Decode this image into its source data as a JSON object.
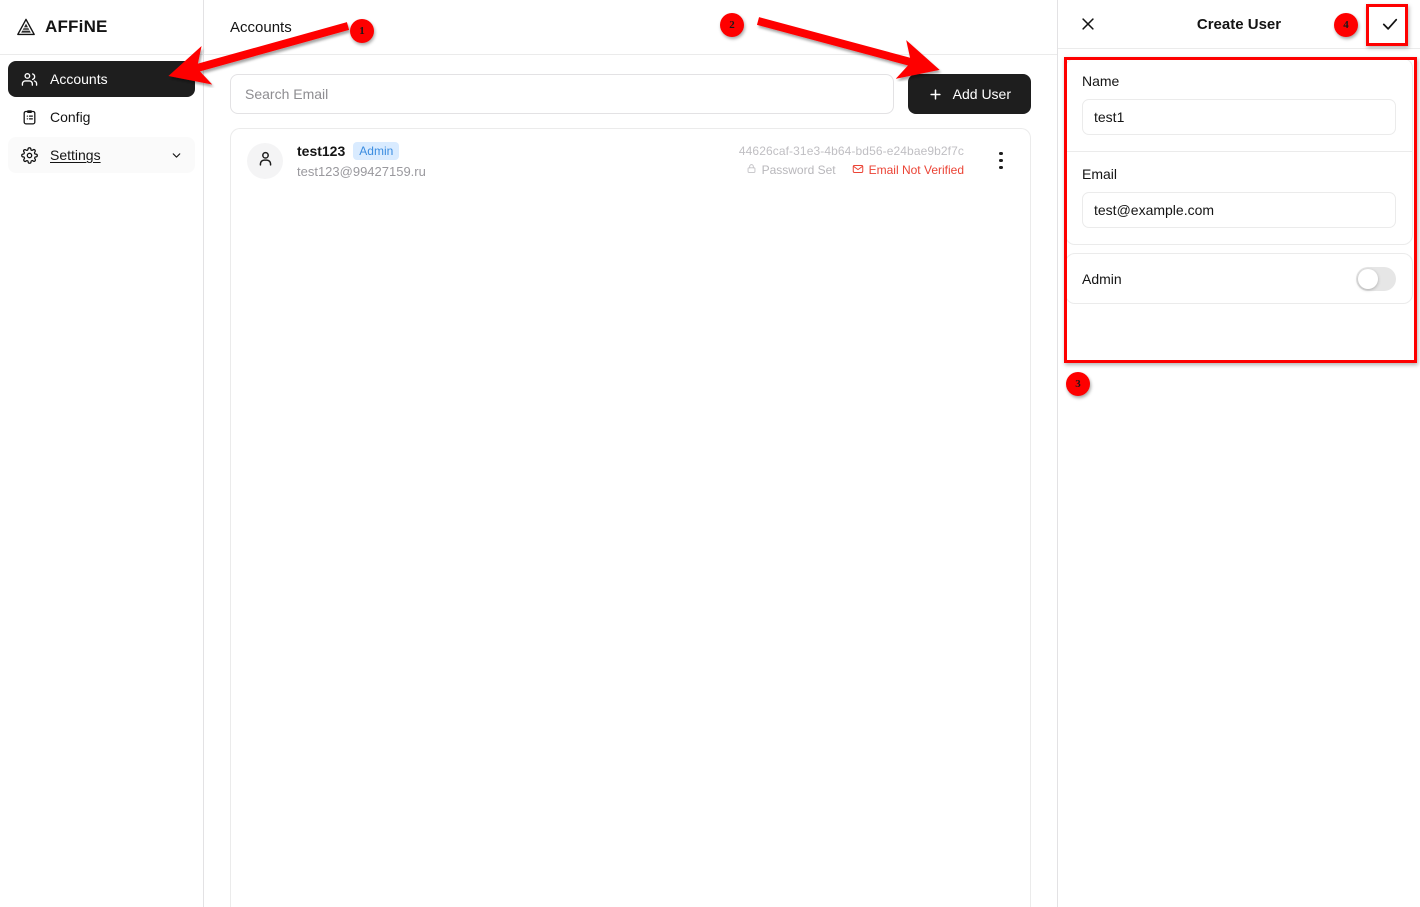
{
  "app": {
    "brand": "AFFiNE",
    "logo_icon": "affine-logo-icon"
  },
  "sidebar": {
    "items": [
      {
        "label": "Accounts",
        "icon": "users-icon",
        "active": true,
        "expandable": false
      },
      {
        "label": "Config",
        "icon": "clipboard-icon",
        "active": false,
        "expandable": false
      },
      {
        "label": "Settings",
        "icon": "gear-icon",
        "active": false,
        "expandable": true,
        "chevron": "chevron-down-icon"
      }
    ]
  },
  "main": {
    "title": "Accounts",
    "search": {
      "placeholder": "Search Email",
      "value": "",
      "icon": "search-input"
    },
    "add_user_button": {
      "label": "Add User",
      "icon": "plus-icon"
    },
    "columns": [
      "user",
      "id",
      "status"
    ],
    "users": [
      {
        "avatar_icon": "user-avatar-icon",
        "name": "test123",
        "badge": "Admin",
        "email": "test123@99427159.ru",
        "id": "44626caf-31e3-4b64-bd56-e24bae9b2f7c",
        "password_status": "Password Set",
        "password_icon": "lock-icon",
        "email_status": "Email Not Verified",
        "email_status_icon": "mail-alert-icon",
        "more_icon": "more-vertical-icon"
      }
    ]
  },
  "panel": {
    "title": "Create User",
    "close_icon": "close-icon",
    "confirm_icon": "check-icon",
    "fields": [
      {
        "label": "Name",
        "value": "test1",
        "placeholder": ""
      },
      {
        "label": "Email",
        "value": "test@example.com",
        "placeholder": ""
      }
    ],
    "toggle": {
      "label": "Admin",
      "state": "off"
    }
  },
  "annotations": {
    "accent_color": "#fe0000",
    "markers": [
      {
        "id": "1",
        "label": "1"
      },
      {
        "id": "2",
        "label": "2"
      },
      {
        "id": "3",
        "label": "3"
      },
      {
        "id": "4",
        "label": "4"
      }
    ]
  },
  "colors": {
    "sidebar_active_bg": "#1e1e1e",
    "button_bg": "#1e1e1e",
    "badge_bg": "#d9ebff",
    "badge_text": "#3a8ce0",
    "error_text": "#eb4335",
    "muted_text": "#9a999e",
    "border": "#ebebeb",
    "annotation": "#fe0000"
  }
}
